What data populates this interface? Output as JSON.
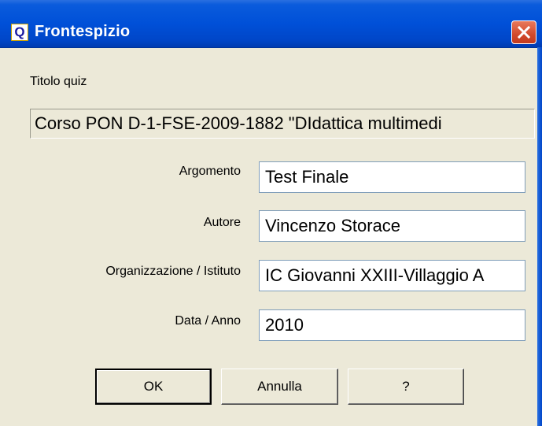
{
  "window": {
    "title": "Frontespizio",
    "icon_letter": "Q",
    "close_icon": "close-icon"
  },
  "form": {
    "titolo_label": "Titolo quiz",
    "titolo_value": "Corso PON D-1-FSE-2009-1882 \"DIdattica multimedi",
    "argomento_label": "Argomento",
    "argomento_value": "Test Finale",
    "autore_label": "Autore",
    "autore_value": "Vincenzo Storace",
    "organizzazione_label": "Organizzazione / Istituto",
    "organizzazione_value": "IC Giovanni XXIII-Villaggio A",
    "data_label": "Data / Anno",
    "data_value": "2010"
  },
  "buttons": {
    "ok": "OK",
    "annulla": "Annulla",
    "help": "?"
  },
  "colors": {
    "titlebar": "#0050d8",
    "dialog_bg": "#ece9d8",
    "close_button": "#d24a2c"
  }
}
